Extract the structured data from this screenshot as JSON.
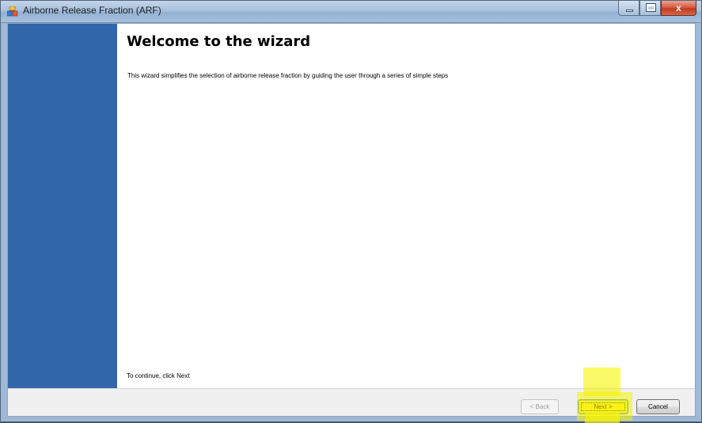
{
  "window": {
    "title": "Airborne Release Fraction (ARF)",
    "icon": "app-icon",
    "controls": {
      "minimize": "minimize-icon",
      "maximize": "maximize-icon",
      "close_glyph": "x"
    }
  },
  "wizard": {
    "heading": "Welcome to the wizard",
    "description": "This wizard simplifies the selection of airborne release fraction by guiding the user through a series of simple steps",
    "continue_hint": "To continue, click Next"
  },
  "buttons": {
    "back": "< Back",
    "next": "Next >",
    "cancel": "Cancel"
  },
  "colors": {
    "sidebar": "#3266aa",
    "highlight": "#f7f300"
  }
}
